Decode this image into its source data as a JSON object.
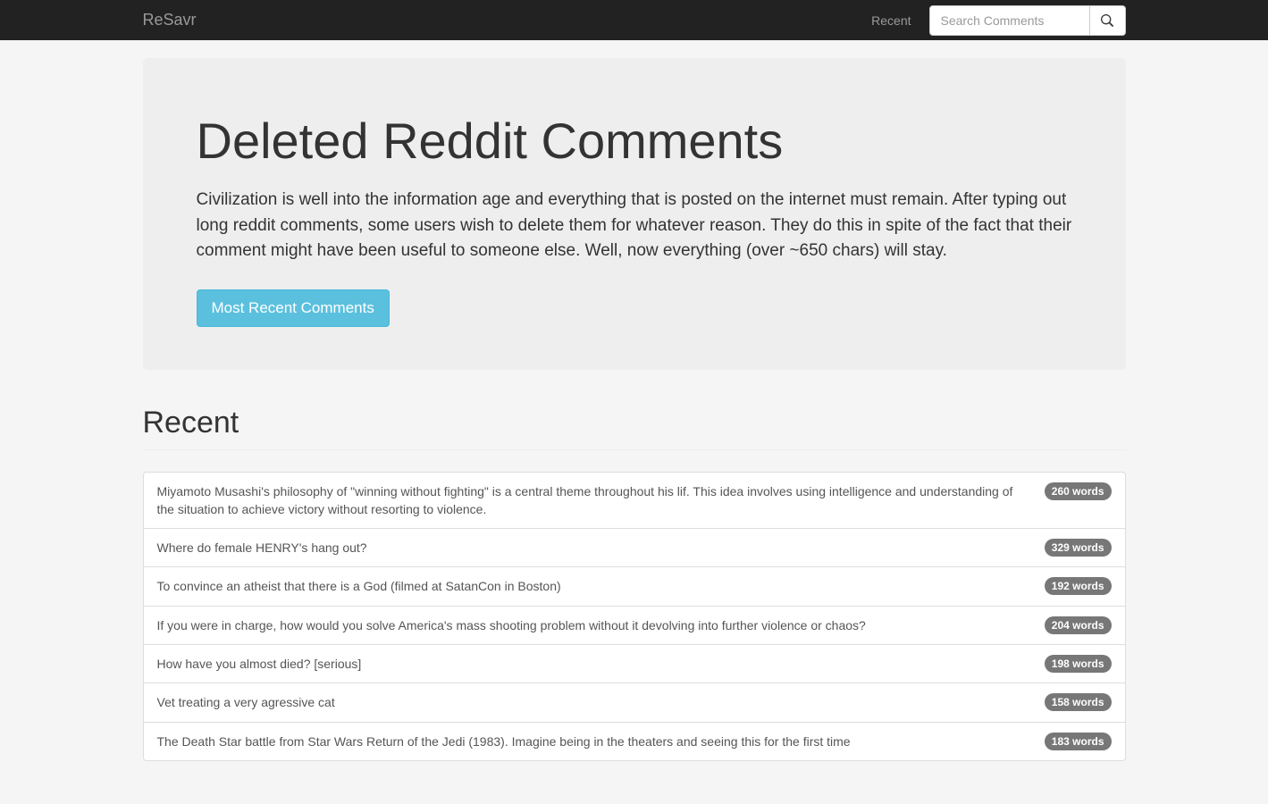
{
  "navbar": {
    "brand": "ReSavr",
    "recent_link": "Recent",
    "search_placeholder": "Search Comments"
  },
  "hero": {
    "title": "Deleted Reddit Comments",
    "description": "Civilization is well into the information age and everything that is posted on the internet must remain. After typing out long reddit comments, some users wish to delete them for whatever reason. They do this in spite of the fact that their comment might have been useful to someone else. Well, now everything (over ~650 chars) will stay.",
    "button_label": "Most Recent Comments"
  },
  "section": {
    "heading": "Recent"
  },
  "comments": [
    {
      "text": "Miyamoto Musashi's philosophy of \"winning without fighting\" is a central theme throughout his lif. This idea involves using intelligence and understanding of the situation to achieve victory without resorting to violence.",
      "badge": "260 words"
    },
    {
      "text": "Where do female HENRY's hang out?",
      "badge": "329 words"
    },
    {
      "text": "To convince an atheist that there is a God (filmed at SatanCon in Boston)",
      "badge": "192 words"
    },
    {
      "text": "If you were in charge, how would you solve America's mass shooting problem without it devolving into further violence or chaos?",
      "badge": "204 words"
    },
    {
      "text": "How have you almost died? [serious]",
      "badge": "198 words"
    },
    {
      "text": "Vet treating a very agressive cat",
      "badge": "158 words"
    },
    {
      "text": "The Death Star battle from Star Wars Return of the Jedi (1983). Imagine being in the theaters and seeing this for the first time",
      "badge": "183 words"
    }
  ]
}
